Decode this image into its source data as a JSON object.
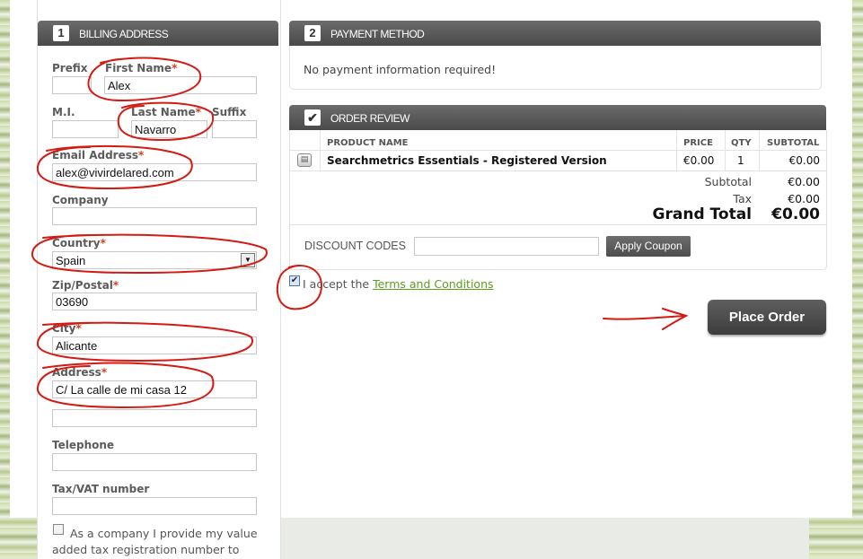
{
  "billing": {
    "step": "1",
    "title": "BILLING ADDRESS",
    "prefix_label": "Prefix",
    "first_name_label": "First Name",
    "first_name_value": "Alex",
    "mi_label": "M.I.",
    "last_name_label": "Last Name",
    "last_name_value": "Navarro",
    "suffix_label": "Suffix",
    "email_label": "Email Address",
    "email_value": "alex@vivirdelared.com",
    "company_label": "Company",
    "country_label": "Country",
    "country_value": "Spain",
    "zip_label": "Zip/Postal",
    "zip_value": "03690",
    "city_label": "City",
    "city_value": "Alicante",
    "address_label": "Address",
    "address_value": "C/ La calle de mi casa 12",
    "telephone_label": "Telephone",
    "vat_label": "Tax/VAT number",
    "vat_checkbox_text_1": "As a company I provide my value",
    "vat_checkbox_text_2": "added tax registration number to",
    "required_mark": "*"
  },
  "payment": {
    "step": "2",
    "title": "PAYMENT METHOD",
    "message": "No payment information required!"
  },
  "review": {
    "step_icon": "checkmark-icon",
    "title": "ORDER REVIEW",
    "col_product": "PRODUCT NAME",
    "col_price": "PRICE",
    "col_qty": "QTY",
    "col_subtotal": "SUBTOTAL",
    "items": [
      {
        "name": "Searchmetrics Essentials - Registered Version",
        "price": "€0.00",
        "qty": "1",
        "subtotal": "€0.00"
      }
    ],
    "subtotal_label": "Subtotal",
    "subtotal_value": "€0.00",
    "tax_label": "Tax",
    "tax_value": "€0.00",
    "grand_total_label": "Grand Total",
    "grand_total_value": "€0.00"
  },
  "discount": {
    "label": "DISCOUNT CODES",
    "input_value": "",
    "button_label": "Apply Coupon"
  },
  "terms": {
    "checked": true,
    "text_prefix": "I accept the",
    "link_text": "Terms and Conditions"
  },
  "place_order_label": "Place Order",
  "colors": {
    "header_bg": "#4a4a4a",
    "annotation_red": "#d41a12",
    "link_green": "#5b9e1c",
    "required_red": "#d0401d"
  }
}
